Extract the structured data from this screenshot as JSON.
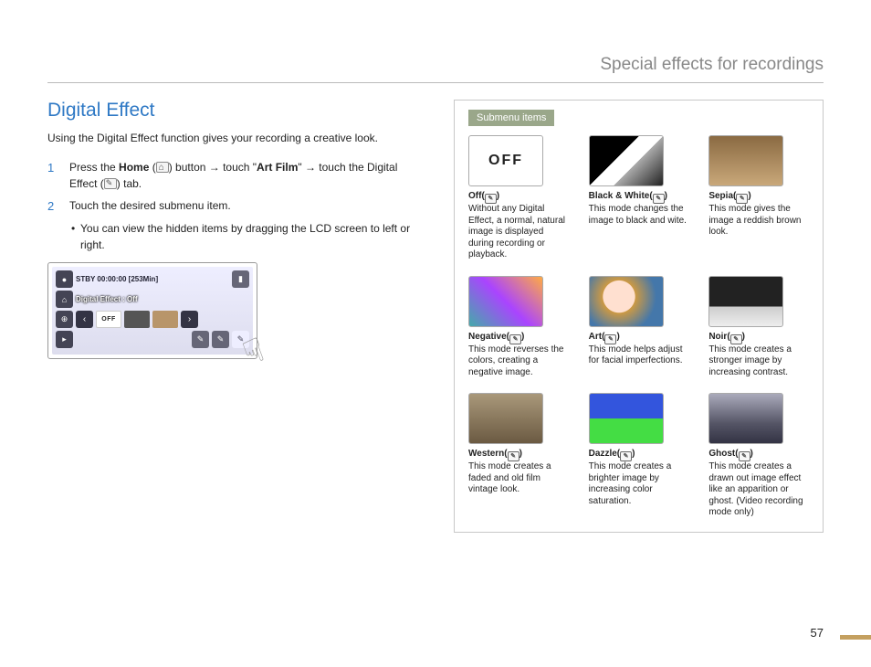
{
  "chapter": "Special effects for recordings",
  "section_title": "Digital Effect",
  "intro": "Using the Digital Effect function gives your recording a creative look.",
  "steps": [
    {
      "num": "1",
      "pre": "Press the ",
      "bold1": "Home",
      "mid": " (",
      "iconA": "home",
      "mid2": ") button → touch \"",
      "bold2": "Art Film",
      "mid3": "\" → touch the Digital Effect (",
      "iconB": "fx",
      "post": ") tab."
    },
    {
      "num": "2",
      "text": "Touch the desired submenu item."
    }
  ],
  "bullet": "You can view the hidden items by dragging the LCD screen to left or right.",
  "lcd": {
    "status": "STBY 00:00:00 [253Min]",
    "label": "Digital Effect : Off",
    "off": "OFF"
  },
  "submenu_label": "Submenu items",
  "items": [
    {
      "sw": "off",
      "title": "Off",
      "desc": "Without any Digital Effect, a normal, natural image is displayed during recording or playback."
    },
    {
      "sw": "bw",
      "title": "Black & White",
      "desc": "This mode changes the image to black and wite."
    },
    {
      "sw": "sep",
      "title": "Sepia",
      "desc": "This mode gives the image a reddish brown look."
    },
    {
      "sw": "neg",
      "title": "Negative",
      "desc": "This mode reverses the colors, creating a negative image."
    },
    {
      "sw": "art",
      "title": "Art",
      "desc": "This mode helps adjust for facial imperfections."
    },
    {
      "sw": "noir",
      "title": "Noir",
      "desc": "This mode creates a stronger image by increasing contrast."
    },
    {
      "sw": "west",
      "title": "Western",
      "desc": "This mode creates a faded and old film vintage look."
    },
    {
      "sw": "daz",
      "title": "Dazzle",
      "desc": "This mode creates a brighter image by increasing color saturation."
    },
    {
      "sw": "ghost",
      "title": "Ghost",
      "desc": "This mode creates a drawn out image effect like an apparition or ghost. (Video recording mode only)"
    }
  ],
  "page_num": "57"
}
